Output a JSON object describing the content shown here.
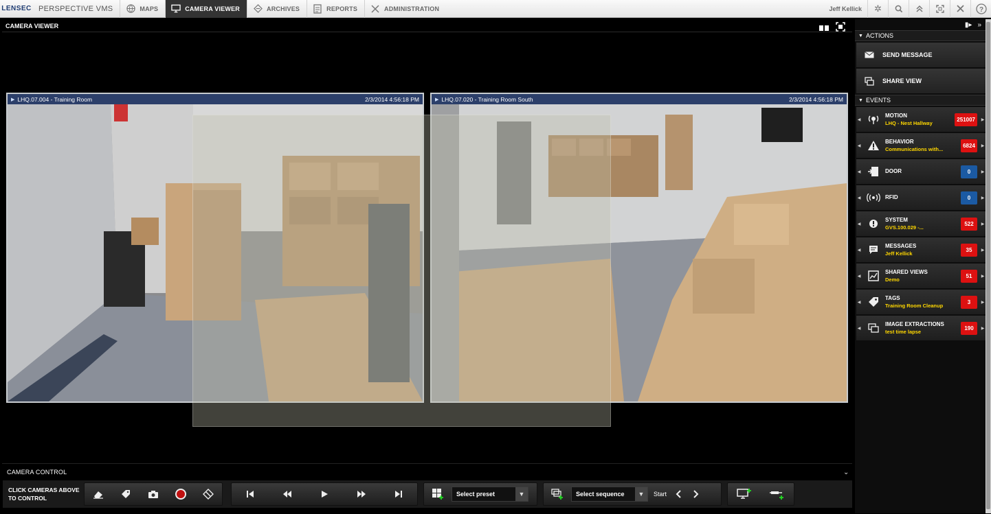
{
  "nav": {
    "logo": "LENSEC",
    "product": "PERSPECTIVE VMS",
    "tabs": [
      {
        "label": "MAPS",
        "icon": "globe-icon"
      },
      {
        "label": "CAMERA VIEWER",
        "icon": "monitor-icon"
      },
      {
        "label": "ARCHIVES",
        "icon": "archive-icon"
      },
      {
        "label": "REPORTS",
        "icon": "report-icon"
      },
      {
        "label": "ADMINISTRATION",
        "icon": "tools-icon"
      }
    ],
    "active_tab": "CAMERA VIEWER",
    "user": "Jeff Kellick",
    "right_icons": [
      "settings-icon",
      "search-icon",
      "collapse-icon",
      "fullscreen-icon",
      "close-icon",
      "help-icon"
    ]
  },
  "viewer": {
    "title": "CAMERA VIEWER",
    "tiles": [
      {
        "name": "LHQ.07.004 - Training Room",
        "timestamp": "2/3/2014 4:56:18 PM"
      },
      {
        "name": "LHQ.07.020 - Training Room South",
        "timestamp": "2/3/2014 4:56:18 PM"
      }
    ]
  },
  "camera_control": {
    "title": "CAMERA CONTROL",
    "hint": "CLICK CAMERAS ABOVE TO CONTROL",
    "preset_placeholder": "Select preset",
    "sequence_placeholder": "Select sequence",
    "start_label": "Start"
  },
  "right_panel": {
    "actions_title": "ACTIONS",
    "actions": [
      {
        "label": "SEND MESSAGE",
        "icon": "envelope-icon"
      },
      {
        "label": "SHARE VIEW",
        "icon": "share-view-icon"
      }
    ],
    "events_title": "EVENTS",
    "events": [
      {
        "name": "MOTION",
        "sub": "LHQ - Nest Hallway",
        "count": "251007",
        "color": "#dd1111",
        "icon": "motion-icon"
      },
      {
        "name": "BEHAVIOR",
        "sub": "Communications with...",
        "count": "6824",
        "color": "#dd1111",
        "icon": "warning-icon"
      },
      {
        "name": "DOOR",
        "sub": "",
        "count": "0",
        "color": "#1b5aa3",
        "icon": "door-icon"
      },
      {
        "name": "RFID",
        "sub": "",
        "count": "0",
        "color": "#1b5aa3",
        "icon": "rfid-icon"
      },
      {
        "name": "SYSTEM",
        "sub": "GVS.100.029 -...",
        "count": "522",
        "color": "#dd1111",
        "icon": "system-icon"
      },
      {
        "name": "MESSAGES",
        "sub": "Jeff Kellick",
        "count": "35",
        "color": "#dd1111",
        "icon": "message-icon"
      },
      {
        "name": "SHARED VIEWS",
        "sub": "Demo",
        "count": "51",
        "color": "#dd1111",
        "icon": "shared-views-icon"
      },
      {
        "name": "TAGS",
        "sub": "Training Room Cleanup",
        "count": "3",
        "color": "#dd1111",
        "icon": "tag-icon"
      },
      {
        "name": "IMAGE EXTRACTIONS",
        "sub": "test time lapse",
        "count": "190",
        "color": "#dd1111",
        "icon": "image-extraction-icon"
      }
    ]
  }
}
